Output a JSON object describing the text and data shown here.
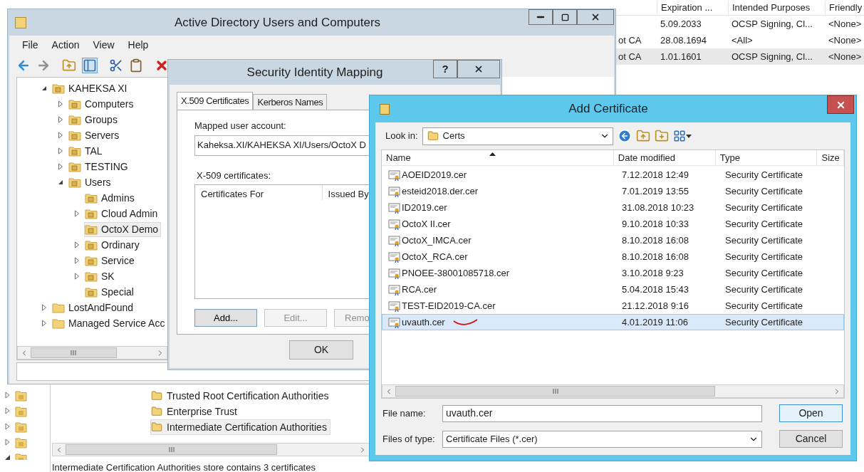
{
  "background_console": {
    "certificates_table": {
      "columns": [
        "Expiration ...",
        "Intended Purposes",
        "Friendly"
      ],
      "rows": [
        {
          "cells": [
            "5.09.2033",
            "OCSP Signing, Cl...",
            "<None>"
          ],
          "selected": false
        },
        {
          "issued_by": "ot CA",
          "cells": [
            "28.08.1694",
            "<All>",
            "<None>"
          ],
          "selected": false
        },
        {
          "issued_by": "ot CA",
          "cells": [
            "1.01.1601",
            "OCSP Signing, Cl...",
            "<None>"
          ],
          "selected": true
        }
      ]
    },
    "store_list": [
      {
        "name": "Trusted Root Certification Authorities",
        "selected": false
      },
      {
        "name": "Enterprise Trust",
        "selected": false
      },
      {
        "name": "Intermediate Certification Authorities",
        "selected": true
      }
    ],
    "status_bar": "Intermediate Certification Authorities store contains 3 certificates"
  },
  "ad_window": {
    "title": "Active Directory Users and Computers",
    "menu": [
      "File",
      "Action",
      "View",
      "Help"
    ],
    "tree": [
      {
        "label": "KAHEKSA XI",
        "kind": "ou",
        "expanded": true,
        "selected": false,
        "children": [
          {
            "label": "Computers",
            "kind": "ou",
            "expanded": false,
            "selected": false
          },
          {
            "label": "Groups",
            "kind": "ou",
            "expanded": false,
            "selected": false
          },
          {
            "label": "Servers",
            "kind": "ou",
            "expanded": false,
            "selected": false
          },
          {
            "label": "TAL",
            "kind": "ou",
            "expanded": false,
            "selected": false
          },
          {
            "label": "TESTING",
            "kind": "ou",
            "expanded": false,
            "selected": false
          },
          {
            "label": "Users",
            "kind": "ou",
            "expanded": true,
            "selected": false,
            "children": [
              {
                "label": "Admins",
                "kind": "ou",
                "selected": false
              },
              {
                "label": "Cloud Admin",
                "kind": "ou",
                "expanded": false,
                "selected": false
              },
              {
                "label": "OctoX Demo",
                "kind": "ou",
                "selected": true
              },
              {
                "label": "Ordinary",
                "kind": "ou",
                "expanded": false,
                "selected": false
              },
              {
                "label": "Service",
                "kind": "ou",
                "expanded": false,
                "selected": false
              },
              {
                "label": "SK",
                "kind": "ou",
                "expanded": false,
                "selected": false
              },
              {
                "label": "Special",
                "kind": "ou",
                "selected": false
              }
            ]
          }
        ]
      },
      {
        "label": "LostAndFound",
        "kind": "container",
        "expanded": false,
        "selected": false
      },
      {
        "label": "Managed Service Acc",
        "kind": "container",
        "expanded": false,
        "selected": false
      }
    ]
  },
  "security_identity_mapping": {
    "title": "Security Identity Mapping",
    "help_button": "?",
    "tabs": [
      {
        "label": "X.509 Certificates",
        "selected": true
      },
      {
        "label": "Kerberos Names",
        "selected": false
      }
    ],
    "mapped_account": {
      "label": "Mapped user account:",
      "value": "Kaheksa.XI/KAHEKSA XI/Users/OctoX D"
    },
    "certificates": {
      "label": "X-509 certificates:",
      "columns": [
        "Certificates For",
        "Issued By"
      ]
    },
    "buttons": [
      {
        "label": "Add...",
        "disabled": false
      },
      {
        "label": "Edit...",
        "disabled": true
      },
      {
        "label": "Remo",
        "disabled": true
      }
    ],
    "ok_button": "OK"
  },
  "add_certificate": {
    "title": "Add Certificate",
    "look_in": {
      "label": "Look in:",
      "value": "Certs"
    },
    "columns": [
      "Name",
      "Date modified",
      "Type",
      "Size"
    ],
    "files": [
      {
        "name": "AOEID2019.cer",
        "date": "7.12.2018 12:49",
        "type": "Security Certificate",
        "selected": false
      },
      {
        "name": "esteid2018.der.cer",
        "date": "7.01.2019 13:55",
        "type": "Security Certificate",
        "selected": false
      },
      {
        "name": "ID2019.cer",
        "date": "31.08.2018 10:23",
        "type": "Security Certificate",
        "selected": false
      },
      {
        "name": "OctoX II.cer",
        "date": "9.10.2018 10:33",
        "type": "Security Certificate",
        "selected": false
      },
      {
        "name": "OctoX_IMCA.cer",
        "date": "8.10.2018 16:08",
        "type": "Security Certificate",
        "selected": false
      },
      {
        "name": "OctoX_RCA.cer",
        "date": "8.10.2018 16:08",
        "type": "Security Certificate",
        "selected": false
      },
      {
        "name": "PNOEE-38001085718.cer",
        "date": "3.10.2018 9:23",
        "type": "Security Certificate",
        "selected": false
      },
      {
        "name": "RCA.cer",
        "date": "5.04.2018 15:43",
        "type": "Security Certificate",
        "selected": false
      },
      {
        "name": "TEST-EID2019-CA.cer",
        "date": "21.12.2018 9:16",
        "type": "Security Certificate",
        "selected": false
      },
      {
        "name": "uvauth.cer",
        "date": "4.01.2019 11:06",
        "type": "Security Certificate",
        "selected": true
      }
    ],
    "file_name": {
      "label": "File name:",
      "value": "uvauth.cer"
    },
    "file_type": {
      "label": "Files of type:",
      "value": "Certificate Files (*.cer)"
    },
    "open_button": "Open",
    "cancel_button": "Cancel"
  }
}
